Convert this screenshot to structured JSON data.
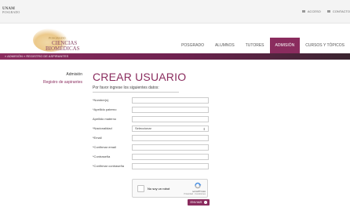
{
  "topbar": {
    "unam_line1": "UNAM",
    "unam_line2": "POSGRADO",
    "links": [
      {
        "label": "ACCESO",
        "icon": "login-icon"
      },
      {
        "label": "CONTACTO",
        "icon": "mail-icon"
      }
    ]
  },
  "logo": {
    "line1": "POSGRADO",
    "line2": "CIENCIAS",
    "line3": "BIOMÉDICAS"
  },
  "nav": {
    "items": [
      {
        "label": "POSGRADO",
        "active": false
      },
      {
        "label": "ALUMNOS",
        "active": false
      },
      {
        "label": "TUTORES",
        "active": false
      },
      {
        "label": "ADMISIÓN",
        "active": true
      },
      {
        "label": "CURSOS Y TÓPICOS",
        "active": false
      }
    ]
  },
  "breadcrumb": {
    "text": "» ADMISIÓN » REGISTRO DE ASPIRANTES"
  },
  "sidebar": {
    "heading": "Admisión",
    "link": "Registro de aspirantes"
  },
  "page": {
    "title": "CREAR USUARIO",
    "subtitle": "Por favor ingrese los siguientes datos:"
  },
  "form": {
    "fields": [
      {
        "label": "*Nombre(s)",
        "value": ""
      },
      {
        "label": "*Apellido paterno",
        "value": ""
      },
      {
        "label": "Apellido materno",
        "value": ""
      },
      {
        "label": "*Nacionalidad",
        "value": "Seleccionar",
        "type": "select"
      },
      {
        "label": "*Email",
        "value": ""
      },
      {
        "label": "*Confirmar email",
        "value": ""
      },
      {
        "label": "*Contraseña",
        "value": ""
      },
      {
        "label": "*Confirmar contraseña",
        "value": ""
      }
    ],
    "captcha": {
      "label": "No soy un robot",
      "brand": "reCAPTCHA",
      "links": "Privacidad - Condiciones"
    },
    "submit_label": "ENVIAR"
  },
  "colors": {
    "brand": "#8a2c5e",
    "brand_dark": "#3a2530"
  }
}
